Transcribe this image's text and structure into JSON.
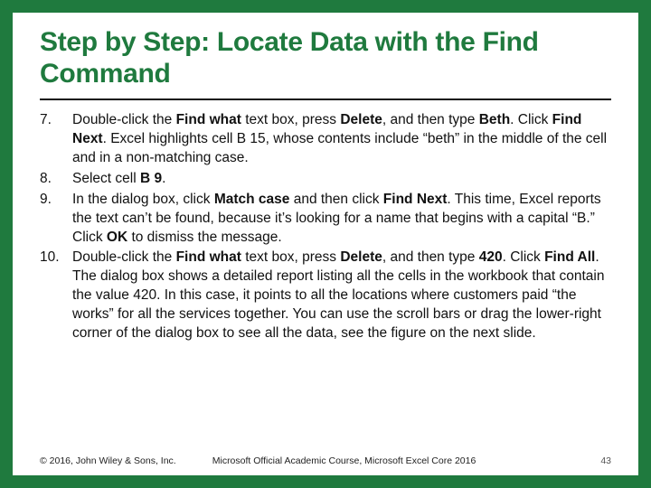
{
  "title": "Step by Step: Locate Data with the Find Command",
  "steps": [
    {
      "n": "7.",
      "html": "Double-click the <b>Find what</b> text box, press <b>Delete</b>, and then type <b>Beth</b>. Click <b>Find Next</b>. Excel highlights cell B 15, whose contents include “beth” in the middle of the cell and in a non-matching case."
    },
    {
      "n": "8.",
      "html": "Select cell <b>B 9</b>."
    },
    {
      "n": "9.",
      "html": "In the dialog box, click <b>Match case</b> and then click <b>Find Next</b>. This time, Excel reports the text can’t be found, because it’s looking for a name that begins with a capital “B.” Click <b>OK</b> to dismiss the message."
    },
    {
      "n": "10.",
      "html": "Double-click the <b>Find what</b> text box, press <b>Delete</b>, and then type <b>420</b>. Click <b>Find All</b>. The dialog box shows a detailed report listing all the cells in the workbook that contain the value 420. In this case, it points to all the locations where customers paid “the works” for all the services together. You can use the scroll bars or drag the lower-right corner of the dialog box to see all the data, see the figure on the next slide."
    }
  ],
  "footer": {
    "copyright": "© 2016, John Wiley & Sons, Inc.",
    "course": "Microsoft Official Academic Course, Microsoft Excel Core 2016",
    "page": "43"
  }
}
